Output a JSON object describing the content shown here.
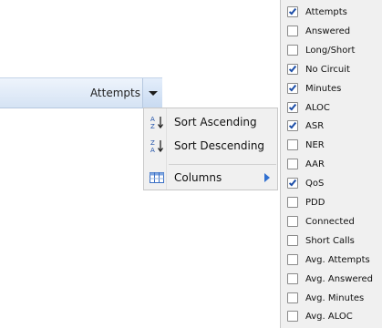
{
  "header": {
    "column_title": "Attempts"
  },
  "menu": {
    "items": [
      {
        "icon": "sort-ascending-icon",
        "label": "Sort Ascending"
      },
      {
        "icon": "sort-descending-icon",
        "label": "Sort Descending"
      },
      {
        "icon": "columns-icon",
        "label": "Columns"
      }
    ]
  },
  "columns": [
    {
      "label": "Attempts",
      "checked": true
    },
    {
      "label": "Answered",
      "checked": false
    },
    {
      "label": "Long/Short",
      "checked": false
    },
    {
      "label": "No Circuit",
      "checked": true
    },
    {
      "label": "Minutes",
      "checked": true
    },
    {
      "label": "ALOC",
      "checked": true
    },
    {
      "label": "ASR",
      "checked": true
    },
    {
      "label": "NER",
      "checked": false
    },
    {
      "label": "AAR",
      "checked": false
    },
    {
      "label": "QoS",
      "checked": true
    },
    {
      "label": "PDD",
      "checked": false
    },
    {
      "label": "Connected",
      "checked": false
    },
    {
      "label": "Short Calls",
      "checked": false
    },
    {
      "label": "Avg. Attempts",
      "checked": false
    },
    {
      "label": "Avg. Answered",
      "checked": false
    },
    {
      "label": "Avg. Minutes",
      "checked": false
    },
    {
      "label": "Avg. ALOC",
      "checked": false
    }
  ]
}
